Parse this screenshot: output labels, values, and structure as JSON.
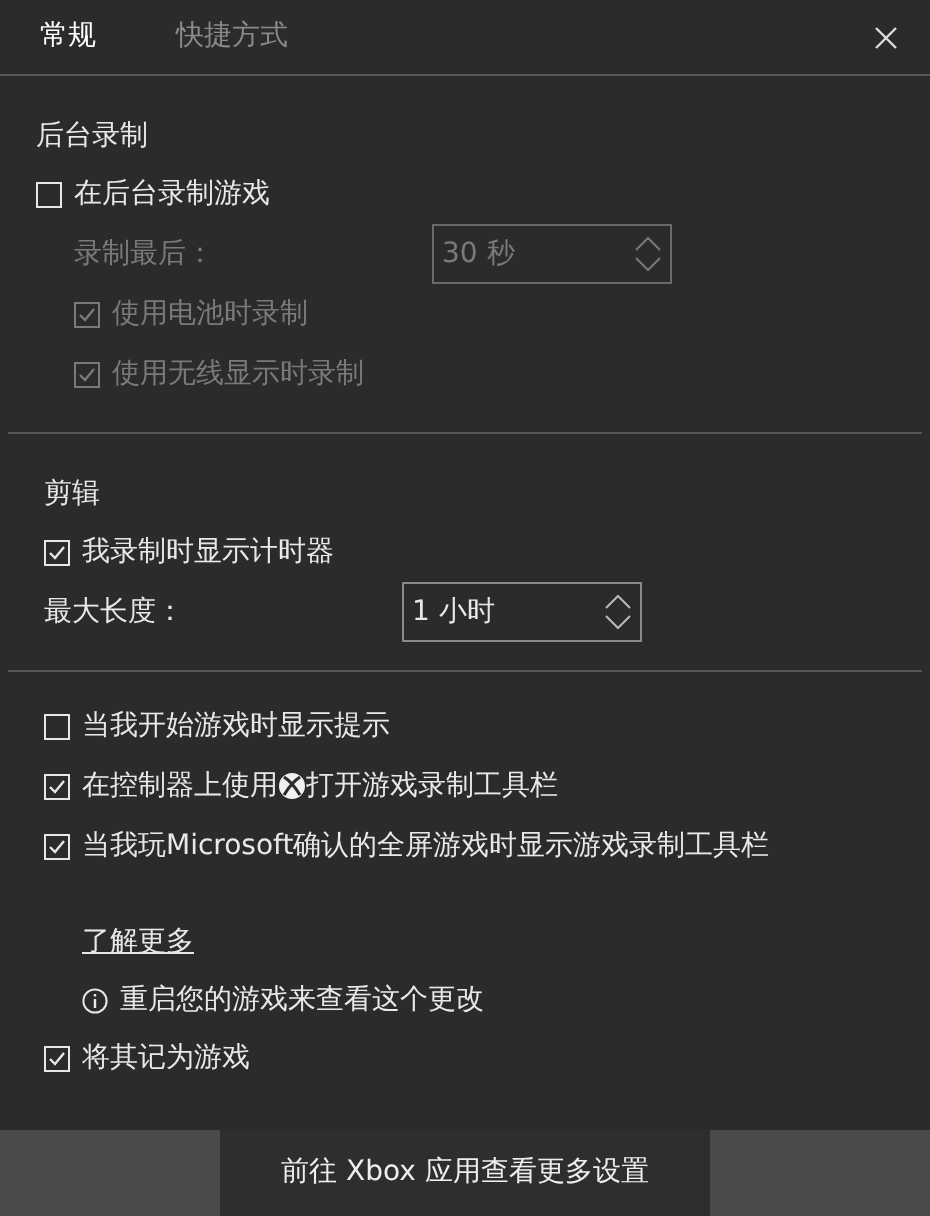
{
  "tabs": [
    {
      "label": "常规",
      "selected": true
    },
    {
      "label": "快捷方式",
      "selected": false
    }
  ],
  "sections": [
    {
      "heading": "后台录制",
      "items": [
        {
          "kind": "checkbox",
          "label": "在后台录制游戏",
          "checked": false,
          "disabled": false,
          "children": [
            {
              "kind": "spinner",
              "label": "录制最后：",
              "value": "30 秒",
              "disabled": true
            },
            {
              "kind": "checkbox",
              "label": "使用电池时录制",
              "checked": true,
              "disabled": true
            },
            {
              "kind": "checkbox",
              "label": "使用无线显示时录制",
              "checked": true,
              "disabled": true
            }
          ]
        }
      ]
    },
    {
      "heading": "剪辑",
      "items": [
        {
          "kind": "checkbox",
          "label": "我录制时显示计时器",
          "checked": true,
          "disabled": false
        },
        {
          "kind": "spinner",
          "label": "最大长度：",
          "value": "1 小时",
          "disabled": false
        }
      ]
    },
    {
      "items": [
        {
          "kind": "checkbox",
          "label": "当我开始游戏时显示提示",
          "checked": false,
          "disabled": false
        },
        {
          "kind": "icon_checkbox",
          "label_start": "在控制器上使用",
          "label_end": "打开游戏录制工具栏",
          "checked": true,
          "disabled": false
        },
        {
          "kind": "checkbox",
          "label": "当我玩Microsoft确认的全屏游戏时显示游戏录制工具栏",
          "checked": true,
          "disabled": false,
          "children": [
            {
              "kind": "link",
              "label": "了解更多"
            },
            {
              "kind": "info",
              "label": "重启您的游戏来查看这个更改"
            }
          ]
        },
        {
          "kind": "checkbox",
          "label": "将其记为游戏",
          "checked": true,
          "disabled": false
        }
      ]
    }
  ],
  "footer_button": "前往 Xbox 应用查看更多设置"
}
